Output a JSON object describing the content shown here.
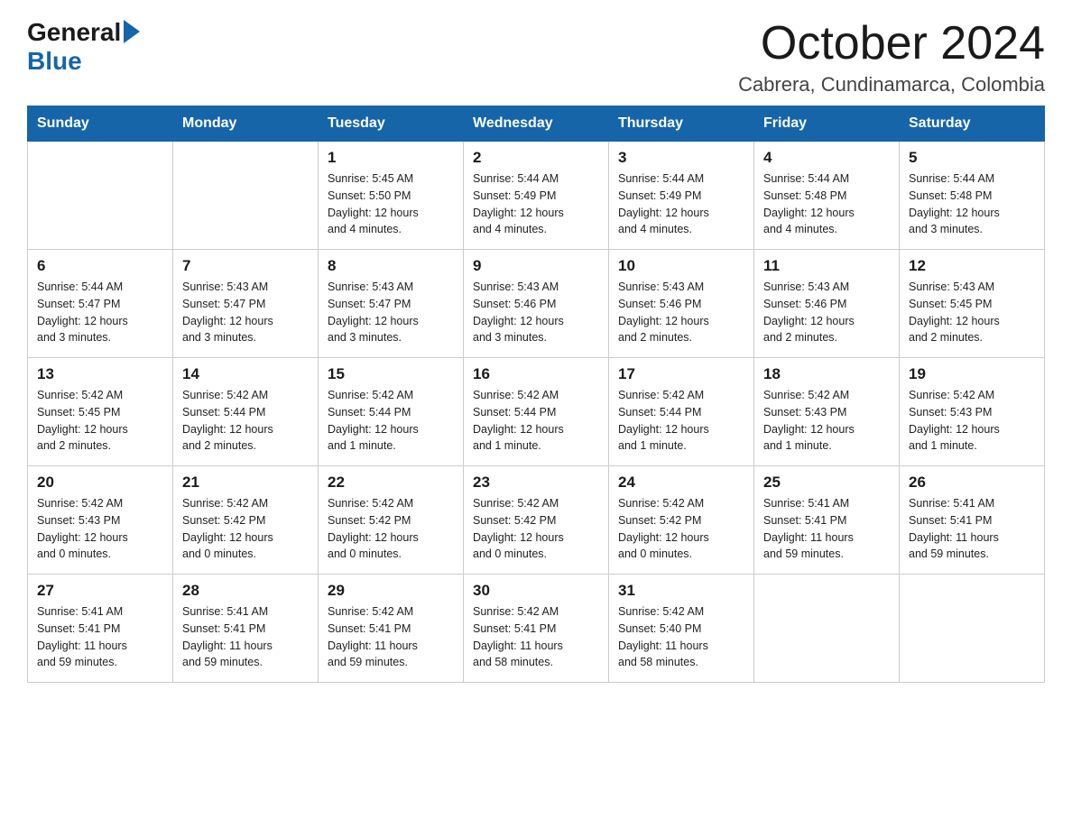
{
  "header": {
    "logo_general": "General",
    "logo_blue": "Blue",
    "month_title": "October 2024",
    "location": "Cabrera, Cundinamarca, Colombia"
  },
  "weekdays": [
    "Sunday",
    "Monday",
    "Tuesday",
    "Wednesday",
    "Thursday",
    "Friday",
    "Saturday"
  ],
  "weeks": [
    [
      {
        "day": "",
        "info": ""
      },
      {
        "day": "",
        "info": ""
      },
      {
        "day": "1",
        "sunrise": "5:45 AM",
        "sunset": "5:50 PM",
        "daylight": "12 hours and 4 minutes."
      },
      {
        "day": "2",
        "sunrise": "5:44 AM",
        "sunset": "5:49 PM",
        "daylight": "12 hours and 4 minutes."
      },
      {
        "day": "3",
        "sunrise": "5:44 AM",
        "sunset": "5:49 PM",
        "daylight": "12 hours and 4 minutes."
      },
      {
        "day": "4",
        "sunrise": "5:44 AM",
        "sunset": "5:48 PM",
        "daylight": "12 hours and 4 minutes."
      },
      {
        "day": "5",
        "sunrise": "5:44 AM",
        "sunset": "5:48 PM",
        "daylight": "12 hours and 3 minutes."
      }
    ],
    [
      {
        "day": "6",
        "sunrise": "5:44 AM",
        "sunset": "5:47 PM",
        "daylight": "12 hours and 3 minutes."
      },
      {
        "day": "7",
        "sunrise": "5:43 AM",
        "sunset": "5:47 PM",
        "daylight": "12 hours and 3 minutes."
      },
      {
        "day": "8",
        "sunrise": "5:43 AM",
        "sunset": "5:47 PM",
        "daylight": "12 hours and 3 minutes."
      },
      {
        "day": "9",
        "sunrise": "5:43 AM",
        "sunset": "5:46 PM",
        "daylight": "12 hours and 3 minutes."
      },
      {
        "day": "10",
        "sunrise": "5:43 AM",
        "sunset": "5:46 PM",
        "daylight": "12 hours and 2 minutes."
      },
      {
        "day": "11",
        "sunrise": "5:43 AM",
        "sunset": "5:46 PM",
        "daylight": "12 hours and 2 minutes."
      },
      {
        "day": "12",
        "sunrise": "5:43 AM",
        "sunset": "5:45 PM",
        "daylight": "12 hours and 2 minutes."
      }
    ],
    [
      {
        "day": "13",
        "sunrise": "5:42 AM",
        "sunset": "5:45 PM",
        "daylight": "12 hours and 2 minutes."
      },
      {
        "day": "14",
        "sunrise": "5:42 AM",
        "sunset": "5:44 PM",
        "daylight": "12 hours and 2 minutes."
      },
      {
        "day": "15",
        "sunrise": "5:42 AM",
        "sunset": "5:44 PM",
        "daylight": "12 hours and 1 minute."
      },
      {
        "day": "16",
        "sunrise": "5:42 AM",
        "sunset": "5:44 PM",
        "daylight": "12 hours and 1 minute."
      },
      {
        "day": "17",
        "sunrise": "5:42 AM",
        "sunset": "5:44 PM",
        "daylight": "12 hours and 1 minute."
      },
      {
        "day": "18",
        "sunrise": "5:42 AM",
        "sunset": "5:43 PM",
        "daylight": "12 hours and 1 minute."
      },
      {
        "day": "19",
        "sunrise": "5:42 AM",
        "sunset": "5:43 PM",
        "daylight": "12 hours and 1 minute."
      }
    ],
    [
      {
        "day": "20",
        "sunrise": "5:42 AM",
        "sunset": "5:43 PM",
        "daylight": "12 hours and 0 minutes."
      },
      {
        "day": "21",
        "sunrise": "5:42 AM",
        "sunset": "5:42 PM",
        "daylight": "12 hours and 0 minutes."
      },
      {
        "day": "22",
        "sunrise": "5:42 AM",
        "sunset": "5:42 PM",
        "daylight": "12 hours and 0 minutes."
      },
      {
        "day": "23",
        "sunrise": "5:42 AM",
        "sunset": "5:42 PM",
        "daylight": "12 hours and 0 minutes."
      },
      {
        "day": "24",
        "sunrise": "5:42 AM",
        "sunset": "5:42 PM",
        "daylight": "12 hours and 0 minutes."
      },
      {
        "day": "25",
        "sunrise": "5:41 AM",
        "sunset": "5:41 PM",
        "daylight": "11 hours and 59 minutes."
      },
      {
        "day": "26",
        "sunrise": "5:41 AM",
        "sunset": "5:41 PM",
        "daylight": "11 hours and 59 minutes."
      }
    ],
    [
      {
        "day": "27",
        "sunrise": "5:41 AM",
        "sunset": "5:41 PM",
        "daylight": "11 hours and 59 minutes."
      },
      {
        "day": "28",
        "sunrise": "5:41 AM",
        "sunset": "5:41 PM",
        "daylight": "11 hours and 59 minutes."
      },
      {
        "day": "29",
        "sunrise": "5:42 AM",
        "sunset": "5:41 PM",
        "daylight": "11 hours and 59 minutes."
      },
      {
        "day": "30",
        "sunrise": "5:42 AM",
        "sunset": "5:41 PM",
        "daylight": "11 hours and 58 minutes."
      },
      {
        "day": "31",
        "sunrise": "5:42 AM",
        "sunset": "5:40 PM",
        "daylight": "11 hours and 58 minutes."
      },
      {
        "day": "",
        "info": ""
      },
      {
        "day": "",
        "info": ""
      }
    ]
  ],
  "labels": {
    "sunrise": "Sunrise:",
    "sunset": "Sunset:",
    "daylight": "Daylight:"
  }
}
